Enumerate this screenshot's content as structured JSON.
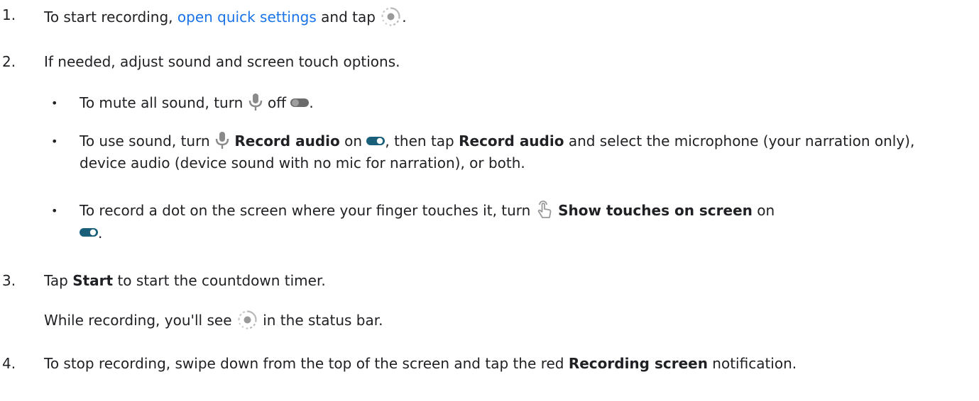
{
  "steps": [
    {
      "number": "1.",
      "text_before": "To start recording, ",
      "link": "open quick settings",
      "text_middle": " and tap ",
      "text_after": "."
    },
    {
      "number": "2.",
      "text": "If needed, adjust sound and screen touch options.",
      "bullets": [
        {
          "text_before": "To mute all sound, turn ",
          "text_middle": " off ",
          "text_after": "."
        },
        {
          "text_before": "To use sound, turn ",
          "bold1": "Record audio",
          "text_mid1": " on ",
          "text_mid2": ", then tap ",
          "bold2": "Record audio",
          "text_after": " and select the microphone (your narration only), device audio (device sound with no mic for narration), or both."
        },
        {
          "text_before": "To record a dot on the screen where your finger touches it, turn ",
          "bold": "Show touches on screen",
          "text_mid": " on ",
          "text_after": "."
        }
      ]
    },
    {
      "number": "3.",
      "text_before": "Tap ",
      "bold": "Start",
      "text_after": " to start the countdown timer.",
      "subtext_before": "While recording, you'll see ",
      "subtext_after": " in the status bar."
    },
    {
      "number": "4.",
      "text_before": "To stop recording, swipe down from the top of the screen and tap the red ",
      "bold": "Recording screen",
      "text_after": " notification."
    }
  ],
  "icons": {
    "record": "screen-record-icon",
    "mic": "microphone-icon",
    "toggle_off": "toggle-off-icon",
    "toggle_on": "toggle-on-icon",
    "touch": "touch-hand-icon"
  },
  "colors": {
    "text": "#202124",
    "link": "#1a73e8",
    "toggle_on": "#1a5f7a",
    "toggle_off": "#6b6b6b",
    "icon_gray": "#8a8a8a"
  }
}
